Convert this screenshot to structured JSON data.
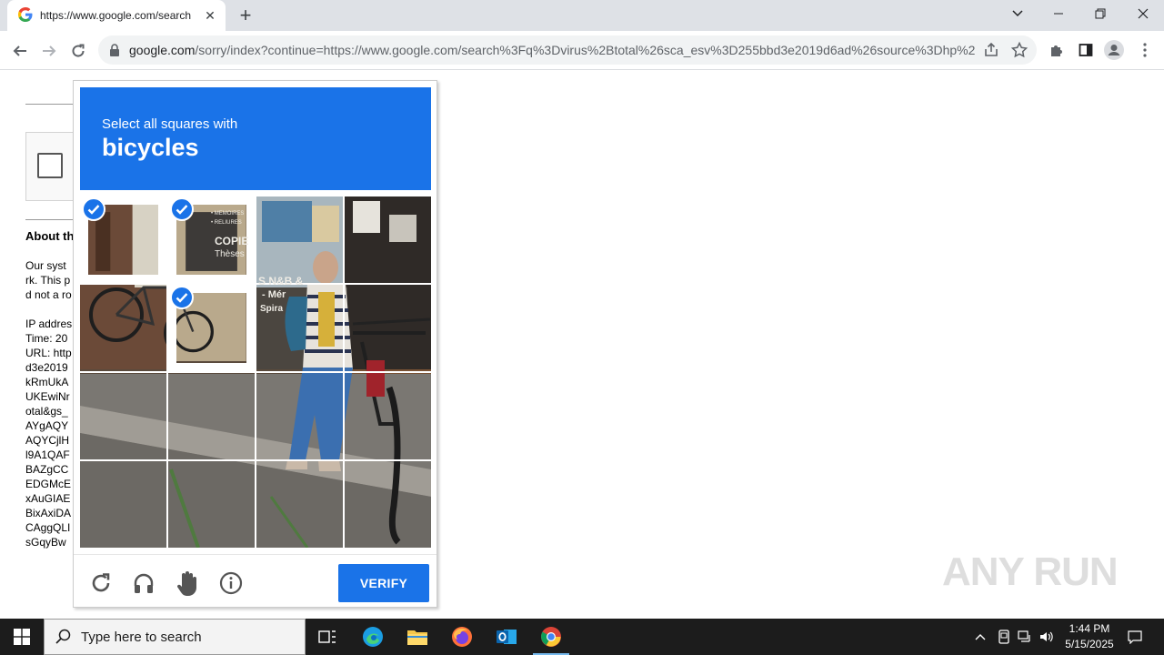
{
  "browser": {
    "tab_title": "https://www.google.com/search",
    "tab_close": "✕",
    "new_tab": "+",
    "url_host": "google.com",
    "url_path": "/sorry/index?continue=https://www.google.com/search%3Fq%3Dvirus%2Btotal%26sca_esv%3D255bbd3e2019d6ad%26source%3Dhp%26..."
  },
  "page": {
    "about_heading": "About th",
    "lines_a": [
      "Our syst",
      "rk. This p",
      "d not a ro"
    ],
    "lines_b": [
      "IP addres",
      "Time: 20",
      "URL: http",
      "d3e2019",
      "kRmUkA",
      "UKEwiNr",
      "otal&gs_",
      "AYgAQY",
      "AQYCjlH",
      "l9A1QAF",
      "BAZgCC",
      "EDGMcE",
      "xAuGIAE",
      "BixAxiDA",
      "CAggQLI",
      "sGqyBw"
    ]
  },
  "captcha": {
    "instruction": "Select all squares with",
    "target": "bicycles",
    "verify_label": "VERIFY",
    "tiles": [
      {
        "selected": true
      },
      {
        "selected": true
      },
      {
        "selected": false
      },
      {
        "selected": false
      },
      {
        "selected": false
      },
      {
        "selected": true
      },
      {
        "selected": false
      },
      {
        "selected": false
      },
      {
        "selected": false
      },
      {
        "selected": false
      },
      {
        "selected": false
      },
      {
        "selected": false
      },
      {
        "selected": false
      },
      {
        "selected": false
      },
      {
        "selected": false
      },
      {
        "selected": false
      }
    ],
    "sign_text": {
      "copie": "COPIE",
      "theses": "Thèses",
      "memoires": "• MEMOIRES",
      "reliures": "• RELIURES",
      "nb": "S N&B &",
      "mer": "- Mér",
      "spira": "Spira"
    }
  },
  "watermark": "ANY RUN",
  "taskbar": {
    "search_placeholder": "Type here to search",
    "time": "1:44 PM",
    "date": "5/15/2025"
  },
  "colors": {
    "accent": "#1a73e8",
    "taskbar": "#1c1c1c",
    "tabstrip": "#dee1e6"
  }
}
